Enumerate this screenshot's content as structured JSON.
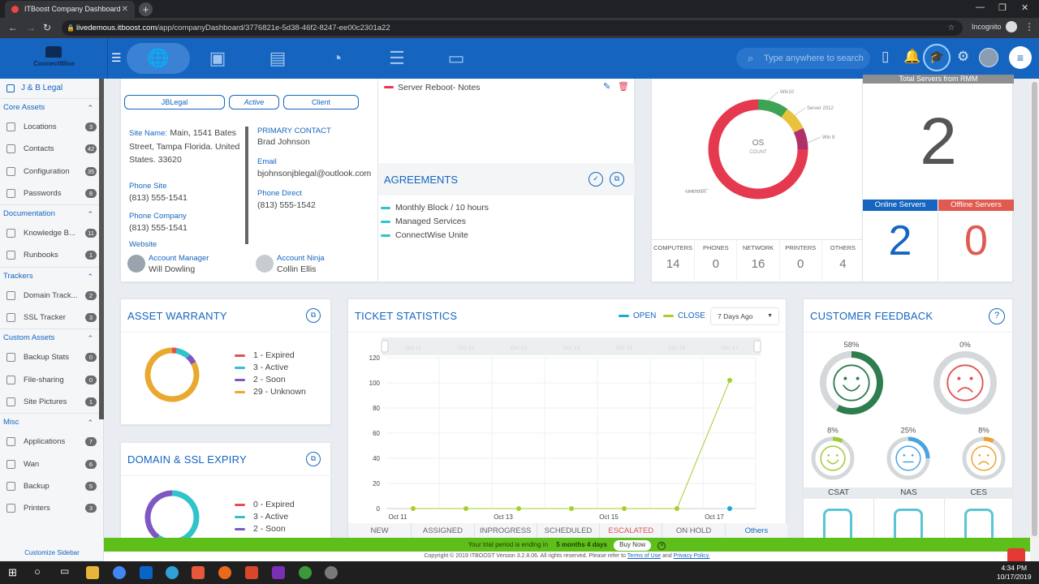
{
  "browser": {
    "tab_title": "ITBoost Company Dashboard",
    "url_host": "livedemous.itboost.com",
    "url_path": "/app/companyDashboard/3776821e-5d38-46f2-8247-ee00c2301a22",
    "incognito_label": "Incognito"
  },
  "header": {
    "logo_text": "ConnectWise",
    "search_placeholder": "Type anywhere to search",
    "nav_icons": [
      "globe-icon",
      "assets-icon",
      "documents-icon",
      "reports-icon",
      "servers-icon",
      "chat-icon"
    ]
  },
  "sidebar": {
    "company": "J & B Legal",
    "customize": "Customize Sidebar",
    "sections": [
      {
        "title": "Core Assets",
        "items": [
          {
            "label": "Locations",
            "count": "3"
          },
          {
            "label": "Contacts",
            "count": "42"
          },
          {
            "label": "Configuration",
            "count": "35"
          },
          {
            "label": "Passwords",
            "count": "8"
          }
        ]
      },
      {
        "title": "Documentation",
        "items": [
          {
            "label": "Knowledge B...",
            "count": "11"
          },
          {
            "label": "Runbooks",
            "count": "1"
          }
        ]
      },
      {
        "title": "Trackers",
        "items": [
          {
            "label": "Domain Track...",
            "count": "2"
          },
          {
            "label": "SSL Tracker",
            "count": "3"
          }
        ]
      },
      {
        "title": "Custom Assets",
        "items": [
          {
            "label": "Backup Stats",
            "count": "0"
          },
          {
            "label": "File-sharing",
            "count": "0"
          },
          {
            "label": "Site Pictures",
            "count": "1"
          }
        ]
      },
      {
        "title": "Misc",
        "items": [
          {
            "label": "Applications",
            "count": "7"
          },
          {
            "label": "Wan",
            "count": "6"
          },
          {
            "label": "Backup",
            "count": "5"
          },
          {
            "label": "Printers",
            "count": "3"
          }
        ]
      }
    ]
  },
  "company_card": {
    "pills": [
      "JBLegal",
      "Active",
      "Client"
    ],
    "site_name_label": "Site Name:",
    "site_name_value": "Main, 1541 Bates Street, Tampa Florida. United States. 33620",
    "phone_site_label": "Phone Site",
    "phone_site": "(813) 555-1541",
    "phone_company_label": "Phone Company",
    "phone_company": "(813) 555-1541",
    "website_label": "Website",
    "primary_contact_label": "PRIMARY CONTACT",
    "primary_contact": "Brad Johnson",
    "email_label": "Email",
    "email": "bjohnsonjblegal@outlook.com",
    "phone_direct_label": "Phone Direct",
    "phone_direct": "(813) 555-1542",
    "account_manager_label": "Account Manager",
    "account_manager": "Will Dowling",
    "account_ninja_label": "Account Ninja",
    "account_ninja": "Collin Ellis",
    "note": "Server Reboot- Notes",
    "agreements_title": "AGREEMENTS",
    "agreements": [
      "Monthly Block / 10 hours",
      "Managed Services",
      "ConnectWise Unite"
    ]
  },
  "os_card": {
    "center_title": "OS",
    "center_sub": "COUNT",
    "slices": [
      {
        "label": "Win10",
        "value": 10,
        "color": "#3ea352"
      },
      {
        "label": "Server 2012",
        "value": 8,
        "color": "#e8c23a"
      },
      {
        "label": "Win 8",
        "value": 7,
        "color": "#b0306a"
      },
      {
        "label": "Unknown",
        "value": 75,
        "color": "#e53950"
      }
    ],
    "counts": [
      {
        "label": "COMPUTERS",
        "value": "14"
      },
      {
        "label": "PHONES",
        "value": "0"
      },
      {
        "label": "NETWORK",
        "value": "16"
      },
      {
        "label": "PRINTERS",
        "value": "0"
      },
      {
        "label": "OTHERS",
        "value": "4"
      }
    ]
  },
  "servers_card": {
    "title": "Total Servers from RMM",
    "total": "2",
    "online_label": "Online Servers",
    "online": "2",
    "offline_label": "Offline Servers",
    "offline": "0",
    "online_color": "#1565c0",
    "offline_color": "#e05a4f"
  },
  "warranty_card": {
    "title": "ASSET WARRANTY",
    "legend": [
      {
        "label": "1 - Expired",
        "value": 1,
        "color": "#e05252"
      },
      {
        "label": "3 - Active",
        "value": 3,
        "color": "#2ec4c9"
      },
      {
        "label": "2 - Soon",
        "value": 2,
        "color": "#7e57c2"
      },
      {
        "label": "29 - Unknown",
        "value": 29,
        "color": "#e8a92e"
      }
    ]
  },
  "domain_card": {
    "title": "DOMAIN & SSL EXPIRY",
    "legend": [
      {
        "label": "0 - Expired",
        "value": 0,
        "color": "#e05252"
      },
      {
        "label": "3 - Active",
        "value": 3,
        "color": "#2ec4c9"
      },
      {
        "label": "2 - Soon",
        "value": 2,
        "color": "#7e57c2"
      }
    ]
  },
  "ticket_card": {
    "title": "TICKET STATISTICS",
    "legend_open": "OPEN",
    "legend_close": "CLOSE",
    "range_select": "7 Days Ago",
    "navigator_labels": [
      "Oct 11",
      "Oct 12",
      "Oct 13",
      "Oct 14",
      "Oct 15",
      "Oct 16",
      "Oct 17"
    ],
    "statuses": [
      "NEW",
      "ASSIGNED",
      "INPROGRESS",
      "SCHEDULED",
      "ESCALATED",
      "ON HOLD",
      "Others"
    ]
  },
  "chart_data": {
    "type": "line",
    "x": [
      "Oct 11",
      "Oct 12",
      "Oct 13",
      "Oct 14",
      "Oct 15",
      "Oct 16",
      "Oct 17"
    ],
    "x_tick_labels": [
      "Oct 11",
      "Oct 13",
      "Oct 15",
      "Oct 17"
    ],
    "series": [
      {
        "name": "CLOSE",
        "values": [
          0,
          0,
          0,
          0,
          0,
          0,
          102
        ],
        "color": "#a6cf2c"
      },
      {
        "name": "OPEN",
        "values": [
          null,
          null,
          null,
          null,
          null,
          null,
          0
        ],
        "color": "#1aa7e0"
      }
    ],
    "ylim": [
      0,
      120
    ],
    "yticks": [
      0,
      20,
      40,
      60,
      80,
      100,
      120
    ],
    "grid": true,
    "legend": "top-right"
  },
  "feedback_card": {
    "title": "CUSTOMER FEEDBACK",
    "top": [
      {
        "pct": "58%",
        "value": 58,
        "color": "#2e7d4f",
        "face": "happy"
      },
      {
        "pct": "0%",
        "value": 0,
        "color": "#e05252",
        "face": "sad"
      }
    ],
    "small": [
      {
        "pct": "8%",
        "value": 8,
        "color": "#9acd32",
        "face": "happy"
      },
      {
        "pct": "25%",
        "value": 25,
        "color": "#4aa3df",
        "face": "neutral"
      },
      {
        "pct": "8%",
        "value": 8,
        "color": "#f0a030",
        "face": "sad"
      }
    ],
    "tabs": [
      "CSAT",
      "NAS",
      "CES"
    ]
  },
  "footer": {
    "trial_text": "Your trial period is ending in",
    "trial_days": "5 months 4 days",
    "buy_label": "Buy Now",
    "copyright_text": "Copyright © 2019 ITBOOST Version 3.2.8.06. All rights reserved. Please refer to",
    "terms": "Terms of Use",
    "and": "and",
    "privacy": "Privacy Policy."
  },
  "taskbar": {
    "time": "4:34 PM",
    "date": "10/17/2019"
  }
}
